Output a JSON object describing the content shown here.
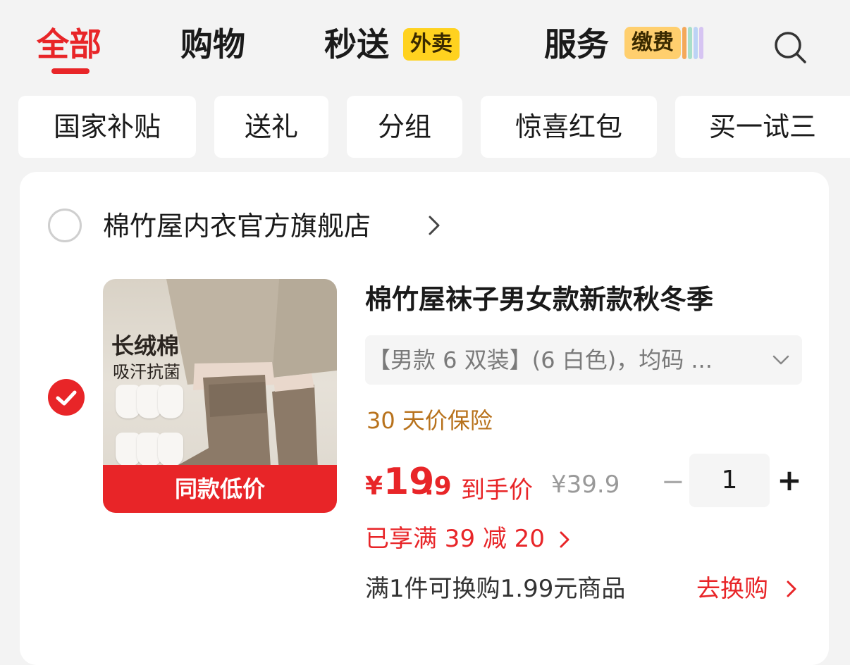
{
  "tabs": {
    "all": "全部",
    "shopping": "购物",
    "express": "秒送",
    "express_badge": "外卖",
    "service": "服务",
    "service_badge": "缴费"
  },
  "chips": [
    "国家补贴",
    "送礼",
    "分组",
    "惊喜红包",
    "买一试三"
  ],
  "store": {
    "name": "棉竹屋内衣官方旗舰店"
  },
  "product": {
    "image_text_1": "长绒棉",
    "image_text_2": "吸汗抗菌",
    "image_banner": "同款低价",
    "title": "棉竹屋袜子男女款新款秋冬季",
    "spec": "【男款 6 双装】(6 白色)，均码 ...",
    "price_protection": "30 天价保险",
    "price_yen": "¥",
    "price_integer": "19",
    "price_decimal": ".9",
    "price_label": "到手价",
    "original_price": "¥39.9",
    "quantity": "1",
    "qty_minus": "−",
    "qty_plus": "+",
    "discount": "已享满 39 减 20",
    "swap_text": "满1件可换购1.99元商品",
    "swap_link": "去换购"
  },
  "colors": {
    "accent_red": "#e82528",
    "price_protection": "#b8721c",
    "badge_yellow": "#ffd21f",
    "badge_orange": "#ffcf6e"
  },
  "icons": [
    "search-icon",
    "chevron-right-icon",
    "chevron-down-icon",
    "check-icon"
  ]
}
